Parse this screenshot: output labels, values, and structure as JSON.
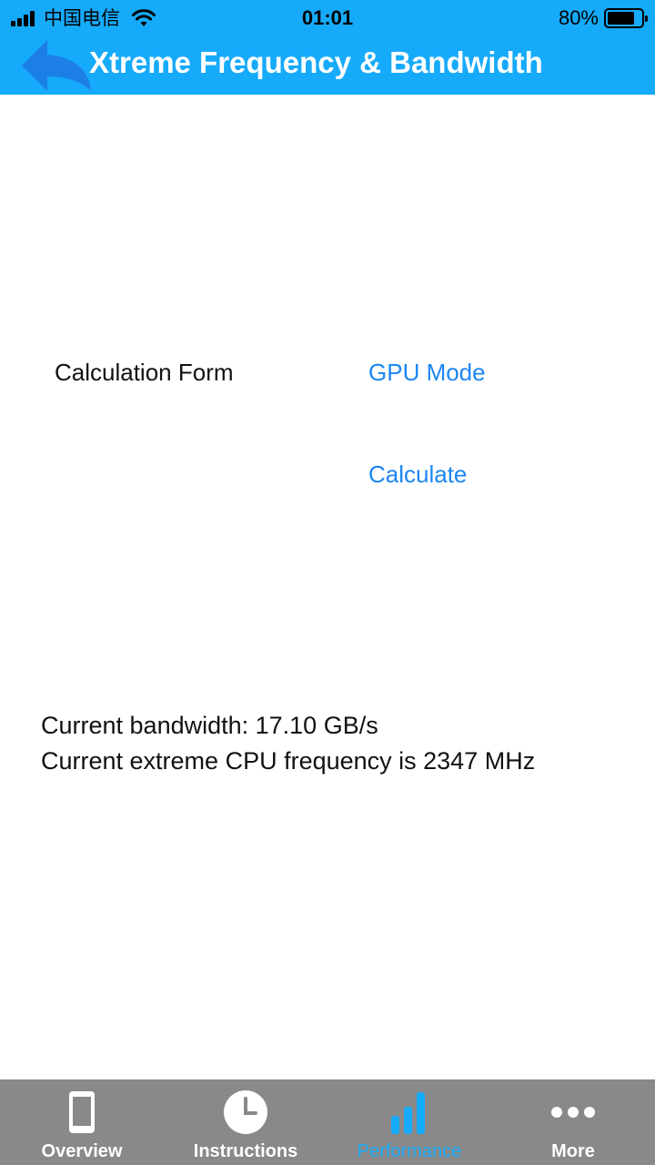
{
  "status_bar": {
    "carrier": "中国电信",
    "time": "01:01",
    "battery_percent": "80%",
    "battery_level": 0.8
  },
  "header": {
    "title": "Xtreme Frequency & Bandwidth",
    "back_icon": "back-arrow-icon"
  },
  "form": {
    "label": "Calculation Form",
    "mode_button": "GPU Mode",
    "calculate_button": "Calculate"
  },
  "results": {
    "bandwidth": "Current bandwidth: 17.10 GB/s",
    "frequency": "Current extreme CPU frequency is 2347 MHz"
  },
  "tabbar": {
    "items": [
      {
        "label": "Overview",
        "icon": "phone-icon",
        "active": false
      },
      {
        "label": "Instructions",
        "icon": "clock-icon",
        "active": false
      },
      {
        "label": "Performance",
        "icon": "bar-chart-icon",
        "active": true
      },
      {
        "label": "More",
        "icon": "more-dots-icon",
        "active": false
      }
    ]
  },
  "colors": {
    "header_bg": "#16aafa",
    "link": "#1c86f2",
    "tabbar_bg": "#898989",
    "tab_active": "#16aafa"
  }
}
